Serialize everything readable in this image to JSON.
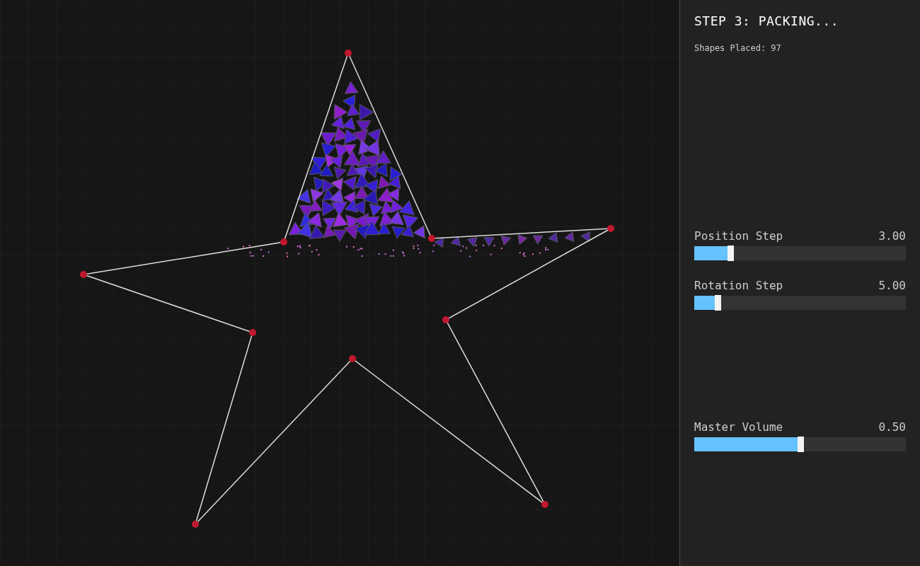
{
  "panel": {
    "title": "STEP 3: PACKING...",
    "status": "Shapes Placed: 97",
    "sliders": [
      {
        "label": "Position Step",
        "reading": "3.00",
        "level": 0.17
      },
      {
        "label": "Rotation Step",
        "reading": "5.00",
        "level": 0.11
      }
    ],
    "audio_sliders": [
      {
        "label": "Master Volume",
        "reading": "0.50",
        "level": 0.5
      }
    ]
  }
}
